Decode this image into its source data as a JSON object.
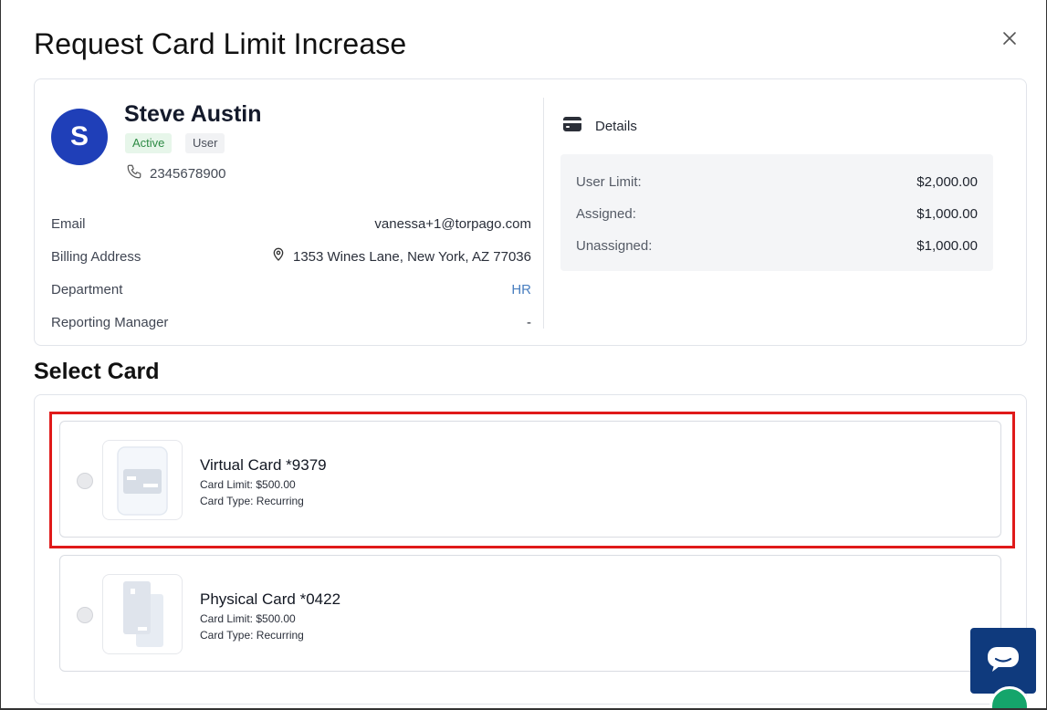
{
  "modal": {
    "title": "Request Card Limit Increase"
  },
  "user": {
    "initial": "S",
    "name": "Steve Austin",
    "status": "Active",
    "role": "User",
    "phone": "2345678900",
    "info": [
      {
        "label": "Email",
        "value": "vanessa+1@torpago.com"
      },
      {
        "label": "Billing Address",
        "value": "1353 Wines Lane, New York, AZ 77036"
      },
      {
        "label": "Department",
        "value": "HR"
      },
      {
        "label": "Reporting Manager",
        "value": "-"
      }
    ]
  },
  "details": {
    "heading": "Details",
    "rows": [
      {
        "label": "User Limit:",
        "value": "$2,000.00"
      },
      {
        "label": "Assigned:",
        "value": "$1,000.00"
      },
      {
        "label": "Unassigned:",
        "value": "$1,000.00"
      }
    ]
  },
  "select_card": {
    "title": "Select Card",
    "cards": [
      {
        "name": "Virtual Card *9379",
        "limit": "Card Limit: $500.00",
        "type": "Card Type: Recurring",
        "icon": "virtual-card-icon"
      },
      {
        "name": "Physical Card *0422",
        "limit": "Card Limit: $500.00",
        "type": "Card Type: Recurring",
        "icon": "physical-card-icon"
      }
    ]
  },
  "colors": {
    "avatar": "#1f3fb8",
    "active_badge": "#2e8b45",
    "link": "#4a7fc0",
    "highlight": "#e01a1a",
    "chat_fab": "#0f3a7d"
  }
}
